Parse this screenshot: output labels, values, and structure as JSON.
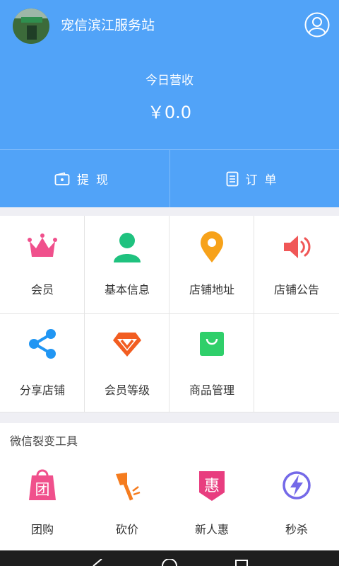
{
  "header": {
    "shop_name": "宠信滨江服务站",
    "revenue_label": "今日营收",
    "revenue_value": "￥0.0"
  },
  "actions": [
    {
      "label": "提现",
      "icon": "wallet-icon"
    },
    {
      "label": "订单",
      "icon": "order-list-icon"
    }
  ],
  "grid": [
    {
      "label": "会员",
      "icon": "crown-icon",
      "color": "#f0508c"
    },
    {
      "label": "基本信息",
      "icon": "person-icon",
      "color": "#1fc27f"
    },
    {
      "label": "店铺地址",
      "icon": "location-pin-icon",
      "color": "#f7a21a"
    },
    {
      "label": "店铺公告",
      "icon": "speaker-icon",
      "color": "#f05757"
    },
    {
      "label": "分享店铺",
      "icon": "share-icon",
      "color": "#2196f3"
    },
    {
      "label": "会员等级",
      "icon": "gem-v-icon",
      "color": "#f25d21"
    },
    {
      "label": "商品管理",
      "icon": "shopping-bag-icon",
      "color": "#2fcf6a"
    }
  ],
  "tools": {
    "title": "微信裂变工具",
    "items": [
      {
        "label": "团购",
        "icon": "group-buy-icon",
        "glyph": "团",
        "color": "#f0508c"
      },
      {
        "label": "砍价",
        "icon": "axe-icon",
        "color": "#f57c1f"
      },
      {
        "label": "新人惠",
        "icon": "new-user-discount-icon",
        "glyph": "惠",
        "color": "#e83d7f"
      },
      {
        "label": "秒杀",
        "icon": "lightning-icon",
        "color": "#7469e8"
      }
    ]
  }
}
